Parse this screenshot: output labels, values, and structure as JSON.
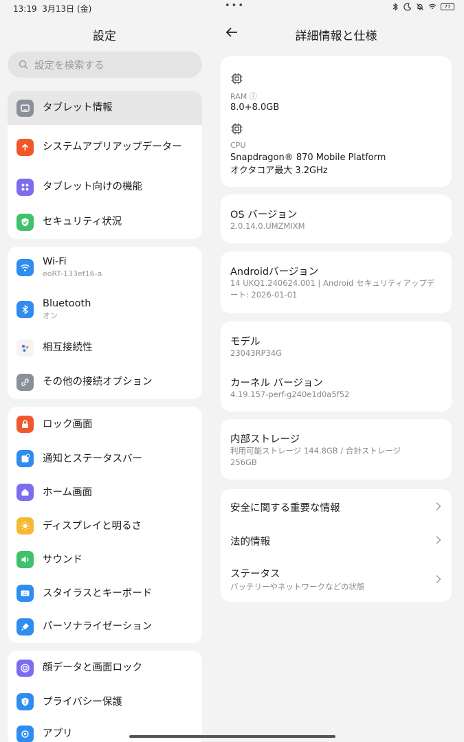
{
  "status": {
    "time": "13:19",
    "date": "3月13日 (金)",
    "battery": "77"
  },
  "settings": {
    "title": "設定",
    "search_placeholder": "設定を検索する",
    "group1": [
      {
        "label": "タブレット情報"
      },
      {
        "label": "システムアプリアップデーター"
      },
      {
        "label": "タブレット向けの機能"
      },
      {
        "label": "セキュリティ状況"
      }
    ],
    "group2": [
      {
        "label": "Wi-Fi",
        "sub": "eoRT-133ef16-a"
      },
      {
        "label": "Bluetooth",
        "sub": "オン"
      },
      {
        "label": "相互接続性"
      },
      {
        "label": "その他の接続オプション"
      }
    ],
    "group3": [
      {
        "label": "ロック画面"
      },
      {
        "label": "通知とステータスバー"
      },
      {
        "label": "ホーム画面"
      },
      {
        "label": "ディスプレイと明るさ"
      },
      {
        "label": "サウンド"
      },
      {
        "label": "スタイラスとキーボード"
      },
      {
        "label": "パーソナライゼーション"
      }
    ],
    "group4": [
      {
        "label": "顔データと画面ロック"
      },
      {
        "label": "プライバシー保護"
      },
      {
        "label": "アプリ"
      }
    ]
  },
  "detail": {
    "title": "詳細情報と仕様",
    "ram_label": "RAM",
    "ram_value": "8.0+8.0GB",
    "cpu_label": "CPU",
    "cpu_value1": "Snapdragon® 870 Mobile Platform",
    "cpu_value2": "オクタコア最大 3.2GHz",
    "os_label": "OS バージョン",
    "os_value": "2.0.14.0.UMZMIXM",
    "android_label": "Androidバージョン",
    "android_value": "14 UKQ1.240624.001 | Android セキュリティアップデート: 2026-01-01",
    "model_label": "モデル",
    "model_value": "23043RP34G",
    "kernel_label": "カーネル バージョン",
    "kernel_value": "4.19.157-perf-g240e1d0a5f52",
    "storage_label": "内部ストレージ",
    "storage_value": "利用可能ストレージ 144.8GB / 合計ストレージ 256GB",
    "links": [
      {
        "label": "安全に関する重要な情報"
      },
      {
        "label": "法的情報"
      },
      {
        "label": "ステータス",
        "sub": "バッテリーやネットワークなどの状態"
      }
    ]
  },
  "colors": {
    "tablet_info": "#8a8f9a",
    "system_update": "#f0582c",
    "tablet_features": "#7b6cf0",
    "security": "#3ec26b",
    "wifi": "#2f8cf0",
    "bluetooth": "#2f8cf0",
    "interconnect": "#f7f7f7",
    "other_conn": "#8a8f9a",
    "lock": "#f0582c",
    "notify": "#2f8cf0",
    "home": "#7b6cf0",
    "display": "#f5b82e",
    "sound": "#3ec26b",
    "stylus": "#2f8cf0",
    "personal": "#2f8cf0",
    "face": "#7b6cf0",
    "privacy": "#2f8cf0",
    "apps": "#2f8cf0"
  }
}
